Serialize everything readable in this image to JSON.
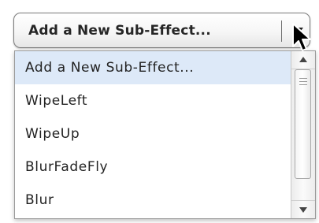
{
  "select": {
    "value": "Add a New Sub-Effect...",
    "arrow_icon": "chevron-down-icon"
  },
  "dropdown": {
    "options": [
      {
        "label": "Add a New Sub-Effect...",
        "selected": true
      },
      {
        "label": "WipeLeft",
        "selected": false
      },
      {
        "label": "WipeUp",
        "selected": false
      },
      {
        "label": "BlurFadeFly",
        "selected": false
      },
      {
        "label": "Blur",
        "selected": false
      }
    ]
  },
  "colors": {
    "selected_row": "#dde9f8",
    "border": "#7c7c7c"
  }
}
